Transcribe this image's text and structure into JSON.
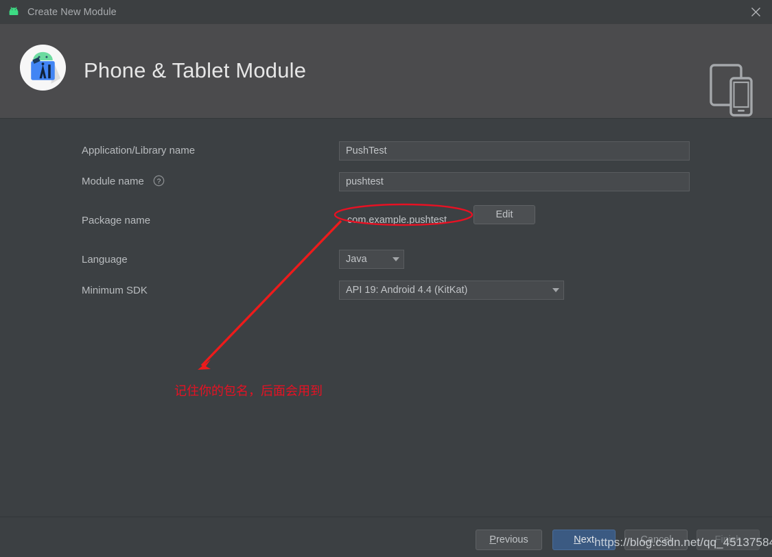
{
  "window": {
    "title": "Create New Module",
    "app_icon": "android-head-icon",
    "close_icon": "close-icon"
  },
  "header": {
    "title": "Phone & Tablet Module",
    "logo_icon": "android-studio-module-icon",
    "device_icon": "phone-and-tablet-icon"
  },
  "form": {
    "fields": [
      {
        "label": "Application/Library name",
        "value": "PushTest",
        "type": "text"
      },
      {
        "label": "Module name",
        "value": "pushtest",
        "type": "text",
        "help_icon": "help-circle-icon"
      },
      {
        "label": "Package name",
        "value": "com.example.pushtest",
        "type": "readonly-with-button",
        "button_label": "Edit"
      },
      {
        "label": "Language",
        "value": "Java",
        "type": "combo"
      },
      {
        "label": "Minimum SDK",
        "value": "API 19: Android 4.4 (KitKat)",
        "type": "combo"
      }
    ],
    "labels": {
      "application_name": "Application/Library name",
      "module_name": "Module name",
      "package_name": "Package name",
      "language": "Language",
      "minimum_sdk": "Minimum SDK"
    },
    "values": {
      "application_name": "PushTest",
      "module_name": "pushtest",
      "package_name": "com.example.pushtest",
      "language": "Java",
      "minimum_sdk": "API 19: Android 4.4 (KitKat)"
    },
    "edit_button": "Edit"
  },
  "annotation": {
    "note": "记住你的包名，后面会用到",
    "color": "#e81123",
    "highlight_target": "com.example.pushtest"
  },
  "footer": {
    "previous": "Previous",
    "previous_mnemonic": "P",
    "next": "Next",
    "next_mnemonic": "N",
    "cancel": "Cancel",
    "finish": "Finish"
  },
  "watermark": {
    "text": "https://blog.csdn.net/qq_45137584"
  },
  "colors": {
    "titlebar_bg": "#3c3f41",
    "header_bg": "#4b4b4d",
    "body_bg": "#3c4043",
    "input_bg": "#474a4d",
    "accent_blue": "#3b5a82",
    "annotation_red": "#e81123",
    "android_green": "#3ddc84"
  }
}
